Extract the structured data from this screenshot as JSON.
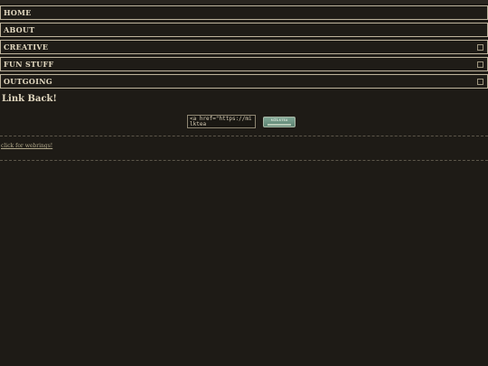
{
  "nav": {
    "items": [
      {
        "label": "HOME",
        "expandable": false
      },
      {
        "label": "ABOUT",
        "expandable": false
      },
      {
        "label": "CREATIVE",
        "expandable": true
      },
      {
        "label": "FUN STUFF",
        "expandable": true
      },
      {
        "label": "OUTGOING",
        "expandable": true
      }
    ]
  },
  "linkback": {
    "title": "Link Back!",
    "code_text": "<a href=\"https://milktea",
    "button_label": "ᴍɪʟᴋᴛᴇᴀ"
  },
  "webrings": {
    "link_label": "click for webrings!"
  },
  "colors": {
    "background": "#1e1b16",
    "text": "#e2d8c0",
    "border": "#bdb39c",
    "button": "#6f9483"
  }
}
